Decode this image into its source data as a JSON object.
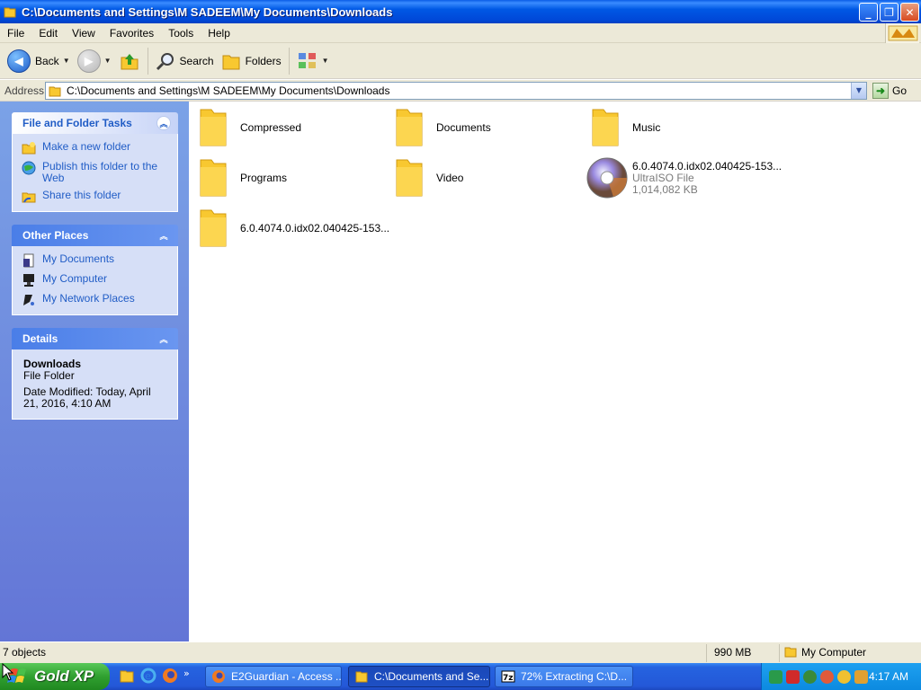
{
  "window": {
    "title": "C:\\Documents and Settings\\M SADEEM\\My Documents\\Downloads",
    "buttons": [
      "minimize",
      "restore",
      "close"
    ]
  },
  "menu": [
    "File",
    "Edit",
    "View",
    "Favorites",
    "Tools",
    "Help"
  ],
  "toolbar": {
    "back_label": "Back",
    "search_label": "Search",
    "folders_label": "Folders"
  },
  "address": {
    "label": "Address",
    "value": "C:\\Documents and Settings\\M SADEEM\\My Documents\\Downloads",
    "go_label": "Go"
  },
  "tasks_panel": {
    "title": "File and Folder Tasks",
    "links": [
      "Make a new folder",
      "Publish this folder to the Web",
      "Share this folder"
    ]
  },
  "places_panel": {
    "title": "Other Places",
    "links": [
      "My Documents",
      "My Computer",
      "My Network Places"
    ]
  },
  "details_panel": {
    "title": "Details",
    "name": "Downloads",
    "type": "File Folder",
    "modified": "Date Modified: Today, April 21, 2016, 4:10 AM"
  },
  "items": [
    {
      "name": "Compressed",
      "kind": "folder"
    },
    {
      "name": "Documents",
      "kind": "folder"
    },
    {
      "name": "Music",
      "kind": "folder"
    },
    {
      "name": "Programs",
      "kind": "folder"
    },
    {
      "name": "Video",
      "kind": "folder"
    },
    {
      "name": "6.0.4074.0.idx02.040425-153...",
      "kind": "iso",
      "type": "UltraISO File",
      "size": "1,014,082 KB"
    },
    {
      "name": "6.0.4074.0.idx02.040425-153...",
      "kind": "folder"
    }
  ],
  "status": {
    "count": "7 objects",
    "size": "990 MB",
    "location": "My Computer"
  },
  "taskbar": {
    "start_label": "Gold XP",
    "tasks": [
      "E2Guardian - Access ...",
      "C:\\Documents and Se...",
      "72% Extracting C:\\D..."
    ],
    "active_task": 1,
    "clock": "4:17 AM",
    "more_quick": "»"
  },
  "colors": {
    "title_blue": "#0058e4",
    "panel_link": "#215dc6",
    "folder_yellow": "#f8c830",
    "start_green": "#30a030"
  }
}
